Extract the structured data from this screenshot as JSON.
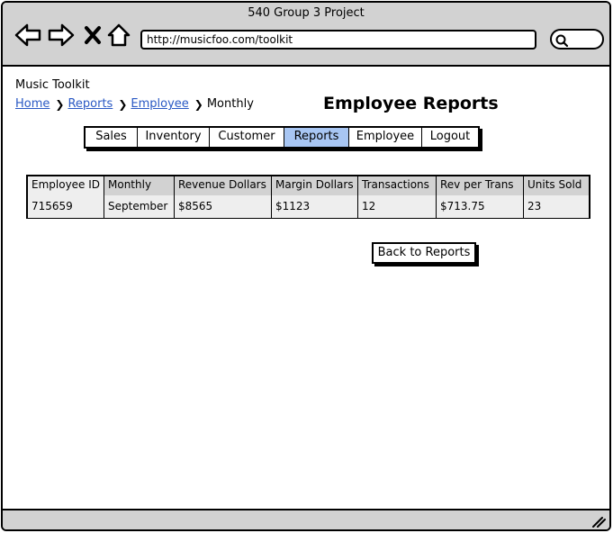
{
  "window": {
    "title": "540 Group 3 Project"
  },
  "browser": {
    "url": "http://musicfoo.com/toolkit",
    "icons": [
      "back-arrow-icon",
      "forward-arrow-icon",
      "stop-icon",
      "home-icon",
      "search-icon"
    ]
  },
  "app": {
    "title": "Music Toolkit"
  },
  "breadcrumb": {
    "items": [
      {
        "label": "Home",
        "link": true
      },
      {
        "label": "Reports",
        "link": true
      },
      {
        "label": "Employee",
        "link": true
      },
      {
        "label": "Monthly",
        "link": false
      }
    ]
  },
  "page": {
    "heading": "Employee Reports"
  },
  "tabs": [
    {
      "label": "Sales",
      "active": false
    },
    {
      "label": "Inventory",
      "active": false
    },
    {
      "label": "Customer",
      "active": false
    },
    {
      "label": "Reports",
      "active": true
    },
    {
      "label": "Employee",
      "active": false
    },
    {
      "label": "Logout",
      "active": false
    }
  ],
  "table": {
    "headers": [
      "Employee ID",
      "Monthly",
      "Revenue Dollars",
      "Margin Dollars",
      "Transactions",
      "Rev per Trans",
      "Units Sold"
    ],
    "rows": [
      [
        "715659",
        "September",
        "$8565",
        "$1123",
        "12",
        "$713.75",
        "23"
      ]
    ]
  },
  "actions": {
    "back_label": "Back to Reports"
  },
  "colors": {
    "chrome": "#d2d2d2",
    "active_tab": "#a8c6f3",
    "link": "#2a59c4"
  }
}
